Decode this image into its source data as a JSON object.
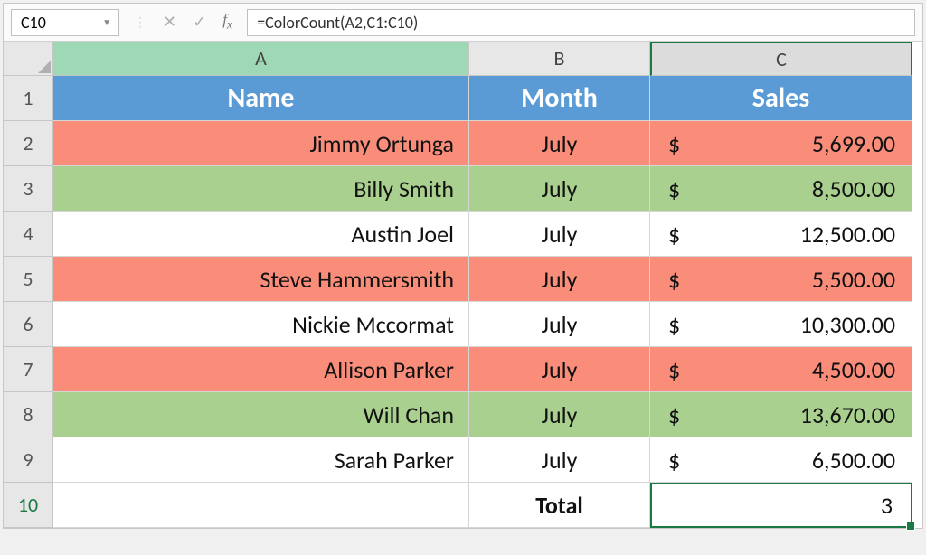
{
  "name_box": "C10",
  "formula": "=ColorCount(A2,C1:C10)",
  "columns": [
    "A",
    "B",
    "C"
  ],
  "row_numbers": [
    "1",
    "2",
    "3",
    "4",
    "5",
    "6",
    "7",
    "8",
    "9",
    "10"
  ],
  "headers": {
    "name": "Name",
    "month": "Month",
    "sales": "Sales"
  },
  "rows": [
    {
      "name": "Jimmy Ortunga",
      "month": "July",
      "sales": "5,699.00",
      "bg": "red"
    },
    {
      "name": "Billy Smith",
      "month": "July",
      "sales": "8,500.00",
      "bg": "green"
    },
    {
      "name": "Austin Joel",
      "month": "July",
      "sales": "12,500.00",
      "bg": "white"
    },
    {
      "name": "Steve Hammersmith",
      "month": "July",
      "sales": "5,500.00",
      "bg": "red"
    },
    {
      "name": "Nickie Mccormat",
      "month": "July",
      "sales": "10,300.00",
      "bg": "white"
    },
    {
      "name": "Allison Parker",
      "month": "July",
      "sales": "4,500.00",
      "bg": "red"
    },
    {
      "name": "Will Chan",
      "month": "July",
      "sales": "13,670.00",
      "bg": "green"
    },
    {
      "name": "Sarah Parker",
      "month": "July",
      "sales": "6,500.00",
      "bg": "white"
    }
  ],
  "total_label": "Total",
  "total_value": "3",
  "currency": "$"
}
